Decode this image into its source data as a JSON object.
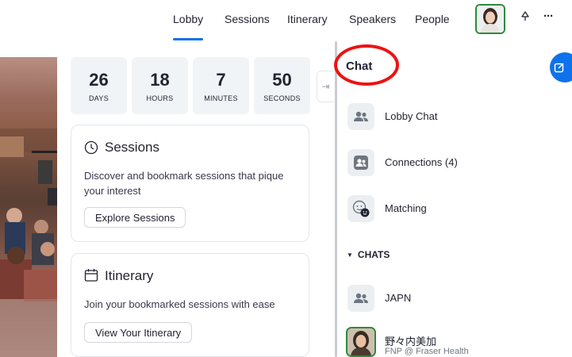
{
  "nav": {
    "tabs": [
      {
        "label": "Lobby",
        "active": true
      },
      {
        "label": "Sessions",
        "active": false
      },
      {
        "label": "Itinerary",
        "active": false
      },
      {
        "label": "Speakers",
        "active": false
      },
      {
        "label": "People",
        "active": false
      }
    ],
    "icons": [
      "profile-avatar",
      "pin-icon",
      "more-icon"
    ],
    "more_glyph": "···"
  },
  "countdown": [
    {
      "value": "26",
      "label": "DAYS"
    },
    {
      "value": "18",
      "label": "HOURS"
    },
    {
      "value": "7",
      "label": "MINUTES"
    },
    {
      "value": "50",
      "label": "SECONDS"
    }
  ],
  "sessions_card": {
    "title": "Sessions",
    "description": "Discover and bookmark sessions that pique your interest",
    "button": "Explore Sessions",
    "icon": "clock-icon"
  },
  "itinerary_card": {
    "title": "Itinerary",
    "description": "Join your bookmarked sessions with ease",
    "button": "View Your Itinerary",
    "icon": "calendar-icon"
  },
  "chat": {
    "title": "Chat",
    "items": [
      {
        "label": "Lobby Chat",
        "icon": "group-icon"
      },
      {
        "label": "Connections (4)",
        "icon": "connections-icon"
      },
      {
        "label": "Matching",
        "icon": "matching-icon"
      }
    ],
    "section_label": "CHATS",
    "chats": [
      {
        "label": "JAPN",
        "icon": "group-icon"
      }
    ],
    "person": {
      "name": "野々内美加",
      "subtitle": "FNP @ Fraser Health"
    }
  },
  "colors": {
    "accent": "#0e72ed",
    "highlight_circle": "#ee1111",
    "avatar_border": "#2d8a3e",
    "card_border": "#e3e6ea"
  }
}
